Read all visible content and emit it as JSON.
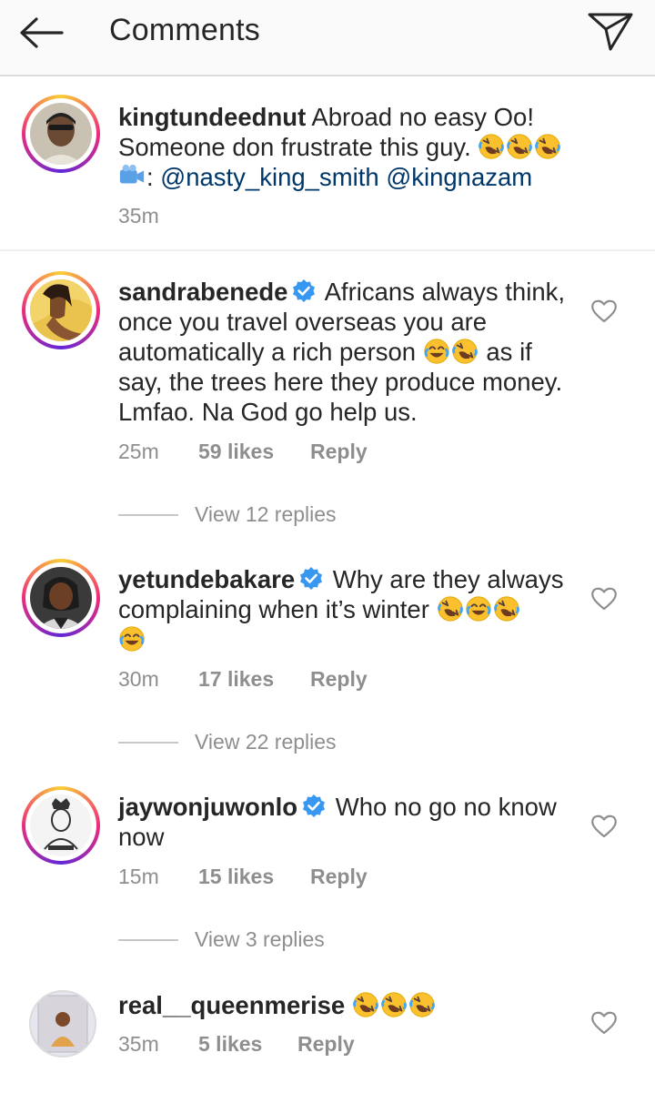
{
  "header": {
    "title": "Comments",
    "back_icon": "arrow-left-icon",
    "send_icon": "paper-plane-icon"
  },
  "caption": {
    "username": "kingtundeednut",
    "text_1": "Abroad no easy Oo! Someone don frustrate this guy.",
    "video_prefix": ":",
    "mention_1": "@nasty_king_smith",
    "mention_2": "@kingnazam",
    "time": "35m"
  },
  "comments": [
    {
      "username": "sandrabenede",
      "verified": true,
      "text_1": "Africans always think, once you travel overseas you are automatically a rich person",
      "text_2": "as if say, the trees here they produce money. Lmfao. Na God go help us.",
      "time": "25m",
      "likes": "59 likes",
      "reply": "Reply",
      "view_replies": "View 12 replies"
    },
    {
      "username": "yetundebakare",
      "verified": true,
      "text_1": "Why are they always complaining when it’s winter",
      "time": "30m",
      "likes": "17 likes",
      "reply": "Reply",
      "view_replies": "View 22 replies"
    },
    {
      "username": "jaywonjuwonlo",
      "verified": true,
      "text_1": "Who no go no know now",
      "time": "15m",
      "likes": "15 likes",
      "reply": "Reply",
      "view_replies": "View 3 replies"
    },
    {
      "username": "real__queenmerise",
      "verified": false,
      "text_1": "",
      "time": "35m",
      "likes": "5 likes",
      "reply": "Reply"
    }
  ],
  "colors": {
    "mention": "#00376b",
    "verified": "#3897f0",
    "muted": "#8e8e8e",
    "emoji_face": "#fbc02d"
  }
}
